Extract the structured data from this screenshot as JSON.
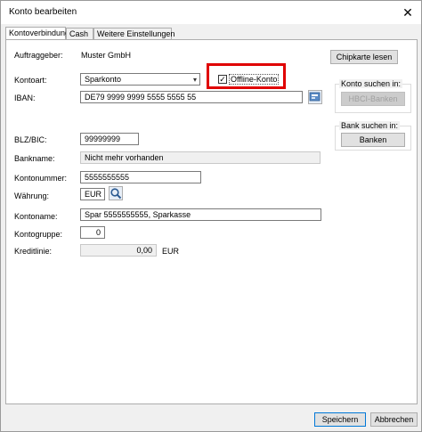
{
  "window": {
    "title": "Konto bearbeiten",
    "close": "✕"
  },
  "tabs": [
    {
      "label": "Kontoverbindung",
      "active": true
    },
    {
      "label": "Cash",
      "active": false
    },
    {
      "label": "Weitere Einstellungen",
      "active": false
    }
  ],
  "form": {
    "auftraggeber_label": "Auftraggeber:",
    "auftraggeber_value": "Muster GmbH",
    "kontoart_label": "Kontoart:",
    "kontoart_value": "Sparkonto",
    "offline_label": "Offline-Konto",
    "offline_checked": "✓",
    "iban_label": "IBAN:",
    "iban_value": "DE79 9999 9999 5555 5555 55",
    "blz_label": "BLZ/BIC:",
    "blz_value": "99999999",
    "bankname_label": "Bankname:",
    "bankname_value": "Nicht mehr vorhanden",
    "kontonummer_label": "Kontonummer:",
    "kontonummer_value": "5555555555",
    "waehrung_label": "Währung:",
    "waehrung_value": "EUR",
    "kontoname_label": "Kontoname:",
    "kontoname_value": "Spar 5555555555, Sparkasse",
    "kontogruppe_label": "Kontogruppe:",
    "kontogruppe_value": "0",
    "kreditlinie_label": "Kreditlinie:",
    "kreditlinie_value": "0,00",
    "kreditlinie_unit": "EUR"
  },
  "side": {
    "chipkarte_label": "Chipkarte lesen",
    "konto_suchen_label": "Konto suchen in:",
    "hbci_banken_label": "HBCI-Banken",
    "bank_suchen_label": "Bank suchen in:",
    "banken_label": "Banken"
  },
  "footer": {
    "speichern_label": "Speichern",
    "abbrechen_label": "Abbrechen"
  },
  "colors": {
    "highlight": "#e00000",
    "accent": "#0078d7"
  }
}
